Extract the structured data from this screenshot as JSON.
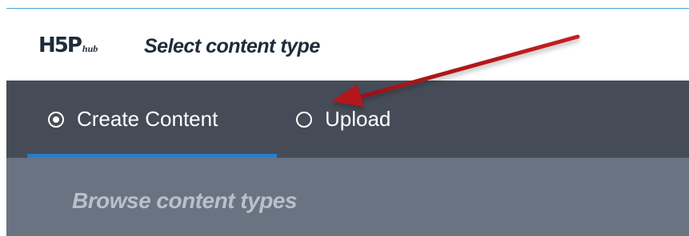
{
  "header": {
    "logo_main": "H5P",
    "logo_sub": "hub",
    "title": "Select content type"
  },
  "tabs": [
    {
      "label": "Create Content",
      "selected": true
    },
    {
      "label": "Upload",
      "selected": false
    }
  ],
  "browse": {
    "label": "Browse content types"
  },
  "annotation": {
    "icon": "arrow-icon",
    "color": "#b3171c"
  },
  "colors": {
    "tabbar_bg": "#464c57",
    "tab_underline": "#2281cb",
    "browse_bg": "#6a7382",
    "browse_text": "#b9c0cb",
    "title_text": "#1f2b3a"
  }
}
